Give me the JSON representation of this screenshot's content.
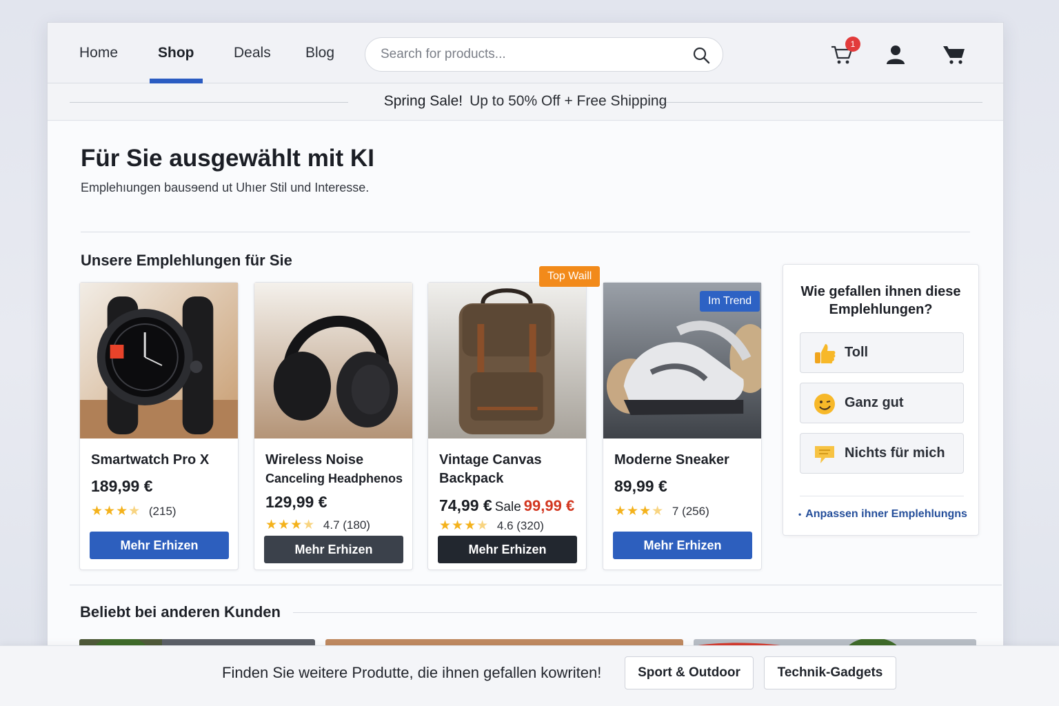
{
  "nav": {
    "links": [
      "Home",
      "Shop",
      "Deals",
      "Blog"
    ],
    "active": "Shop",
    "search_placeholder": "Search for products...",
    "cart_count": "1",
    "icons": [
      "cart-icon",
      "user-icon",
      "shopping-cart-icon",
      "search-icon"
    ]
  },
  "banner": {
    "highlight": "Spring Sale!",
    "text": "Up to 50% Off + Free Shipping"
  },
  "page": {
    "title": "Für Sie ausgewählt mit KI",
    "subtitle": "Emplehıungen bausɘend ut Uhıer Stil und Interesse."
  },
  "recommendations": {
    "section_title": "Unsere Emplehlungen für Sie",
    "products": [
      {
        "name": "Smartwatch Pro X",
        "name2": "",
        "price": "189,99 €",
        "rating_text": "(215)",
        "button": "Mehr Erhizen",
        "badge": ""
      },
      {
        "name": "Wireless Noise",
        "name2": "Canceling Headphenos",
        "price": "129,99 €",
        "rating_text": "4.7 (180)",
        "button": "Mehr Erhizen",
        "badge": ""
      },
      {
        "name": "Vintage Canvas",
        "name2": "Backpack",
        "price": "74,99 €",
        "sale_label": "Sale",
        "sale_price": "99,99 €",
        "rating_text": "4.6 (320)",
        "button": "Mehr Erhizen",
        "badge": "Top Waill"
      },
      {
        "name": "Moderne Sneaker",
        "name2": "",
        "price": "89,99 €",
        "rating_text": "7 (256)",
        "button": "Mehr Erhizen",
        "badge": "Im Trend"
      }
    ],
    "star_glyphs": "★★★"
  },
  "feedback": {
    "title": "Wie gefallen ihnen diese Emplehlungen?",
    "options": [
      "Toll",
      "Ganz gut",
      "Nichts für mich"
    ],
    "link": "Anpassen ihner Emplehlungns"
  },
  "popular": {
    "section_title": "Beliebt bei anderen Kunden"
  },
  "bottom_bar": {
    "text": "Finden Sie weitere Produtte, die ihnen gefallen kowriten!",
    "chips": [
      "Sport & Outdoor",
      "Technik-Gadgets"
    ]
  },
  "colors": {
    "accent": "#2b5cc2",
    "sale": "#d2361f",
    "badge_orange": "#f28a1a",
    "badge_blue": "#2d62c4",
    "star": "#f4b21c"
  }
}
